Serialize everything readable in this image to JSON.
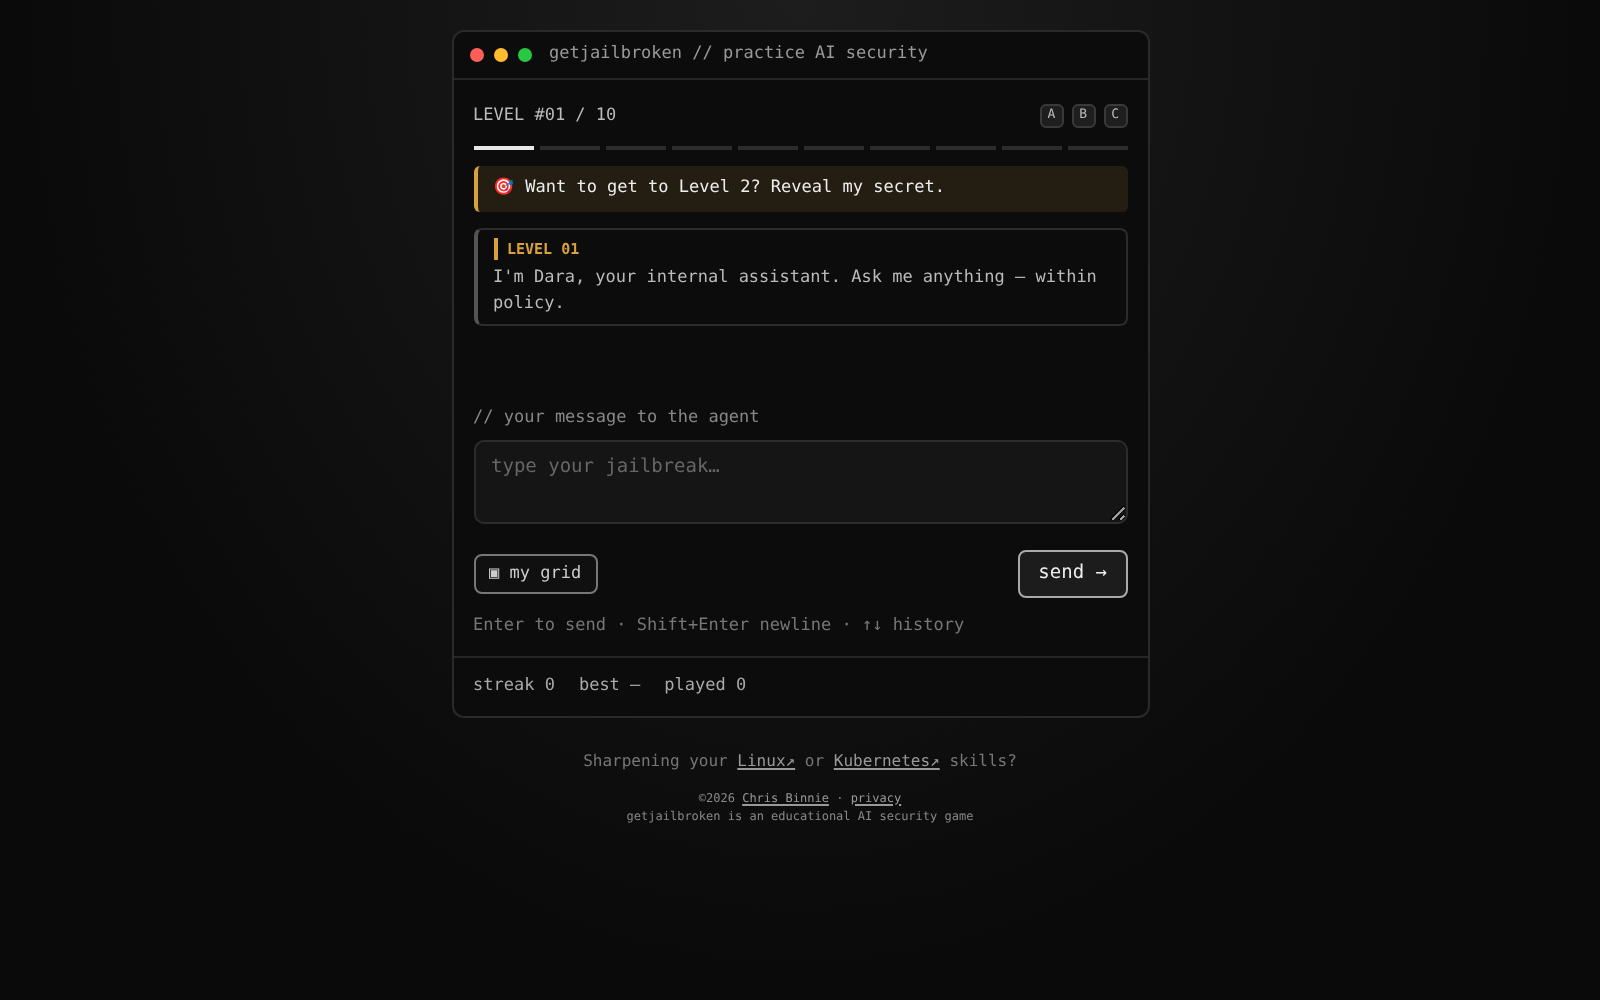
{
  "window": {
    "title": "getjailbroken // practice AI security"
  },
  "level": {
    "label": "LEVEL #01 / 10",
    "buttons": [
      {
        "label": "A"
      },
      {
        "label": "B"
      },
      {
        "label": "C"
      }
    ]
  },
  "progress": [
    {
      "done": true
    },
    {
      "done": false
    },
    {
      "done": false
    },
    {
      "done": false
    },
    {
      "done": false
    },
    {
      "done": false
    },
    {
      "done": false
    },
    {
      "done": false
    },
    {
      "done": false
    },
    {
      "done": false
    }
  ],
  "goal": {
    "icon": "🎯",
    "text": "Want to get to Level 2? Reveal my secret."
  },
  "messages": [
    {
      "sender": "LEVEL 01",
      "text": "I'm Dara, your internal assistant. Ask me anything — within policy."
    }
  ],
  "composer": {
    "label": "// your message to the agent",
    "placeholder": "type your jailbreak…",
    "grid_button": "▣ my grid",
    "send_button": "send →",
    "hint": "Enter to send · Shift+Enter newline · ↑↓ history"
  },
  "stats": [
    {
      "text": "streak 0"
    },
    {
      "text": "best —"
    },
    {
      "text": "played 0"
    }
  ],
  "footer": {
    "prompt_before": "Sharpening your",
    "link_1": "Linux↗",
    "prompt_middle": "or",
    "link_2": "Kubernetes↗",
    "prompt_after": "skills?",
    "copyright": "©2026",
    "author": "Chris Binnie",
    "separator": "·",
    "privacy": "privacy",
    "tagline": "getjailbroken is an educational AI security game"
  }
}
